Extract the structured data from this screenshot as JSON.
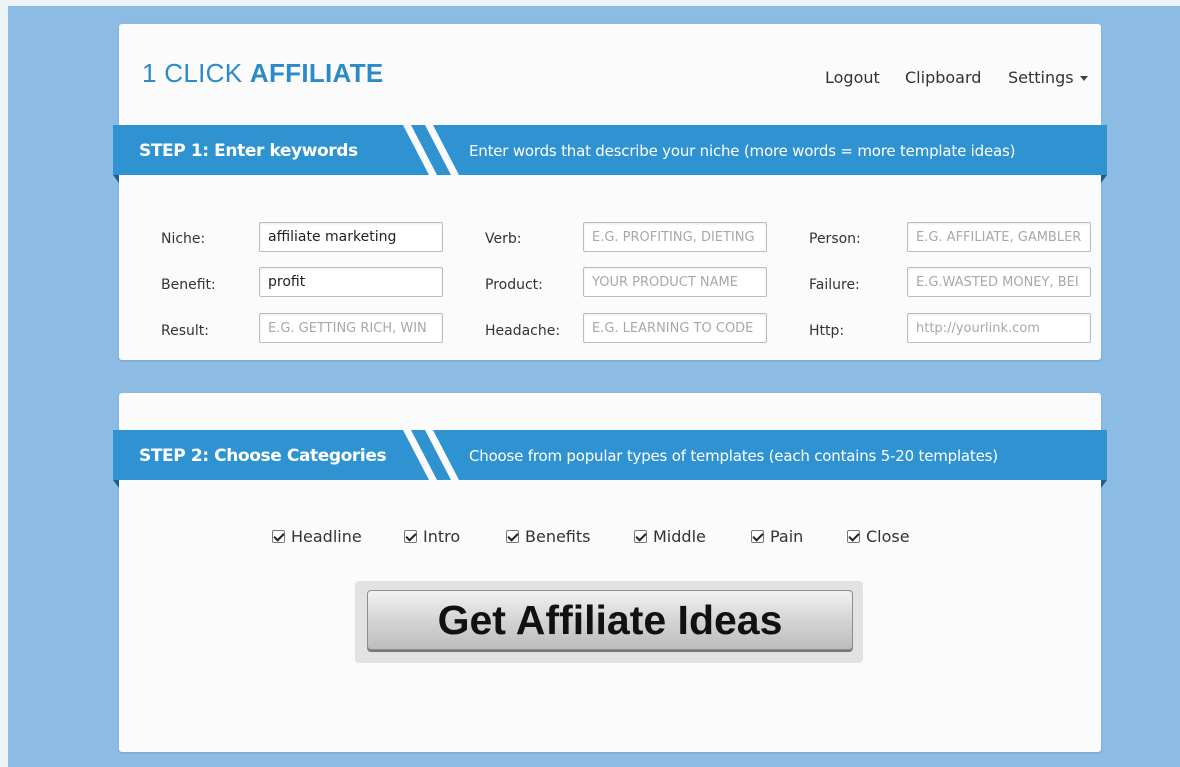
{
  "header": {
    "brand_prefix": "1 CLICK ",
    "brand_bold": "AFFILIATE",
    "nav": {
      "logout": "Logout",
      "clipboard": "Clipboard",
      "settings": "Settings"
    }
  },
  "step1": {
    "title": "STEP 1: Enter keywords",
    "description": "Enter words that describe your niche (more words = more template ideas)",
    "fields": {
      "niche": {
        "label": "Niche:",
        "value": "affiliate marketing",
        "placeholder": ""
      },
      "verb": {
        "label": "Verb:",
        "value": "",
        "placeholder": "E.G. PROFITING, DIETING"
      },
      "person": {
        "label": "Person:",
        "value": "",
        "placeholder": "E.G. AFFILIATE, GAMBLER"
      },
      "benefit": {
        "label": "Benefit:",
        "value": "profit",
        "placeholder": ""
      },
      "product": {
        "label": "Product:",
        "value": "",
        "placeholder": "YOUR PRODUCT NAME"
      },
      "failure": {
        "label": "Failure:",
        "value": "",
        "placeholder": "E.G.WASTED MONEY, BEI"
      },
      "result": {
        "label": "Result:",
        "value": "",
        "placeholder": "E.G. GETTING RICH, WIN"
      },
      "headache": {
        "label": "Headache:",
        "value": "",
        "placeholder": "E.G. LEARNING TO CODE"
      },
      "http": {
        "label": "Http:",
        "value": "",
        "placeholder": "http://yourlink.com"
      }
    }
  },
  "step2": {
    "title": "STEP 2: Choose Categories",
    "description": "Choose from popular types of templates (each contains 5-20 templates)",
    "categories": [
      {
        "label": "Headline",
        "checked": true
      },
      {
        "label": "Intro",
        "checked": true
      },
      {
        "label": "Benefits",
        "checked": true
      },
      {
        "label": "Middle",
        "checked": true
      },
      {
        "label": "Pain",
        "checked": true
      },
      {
        "label": "Close",
        "checked": true
      }
    ],
    "button_label": "Get Affiliate Ideas"
  },
  "colors": {
    "page_background": "#8cbce4",
    "ribbon_blue": "#2f93d2",
    "brand_blue": "#2a8bc7"
  }
}
